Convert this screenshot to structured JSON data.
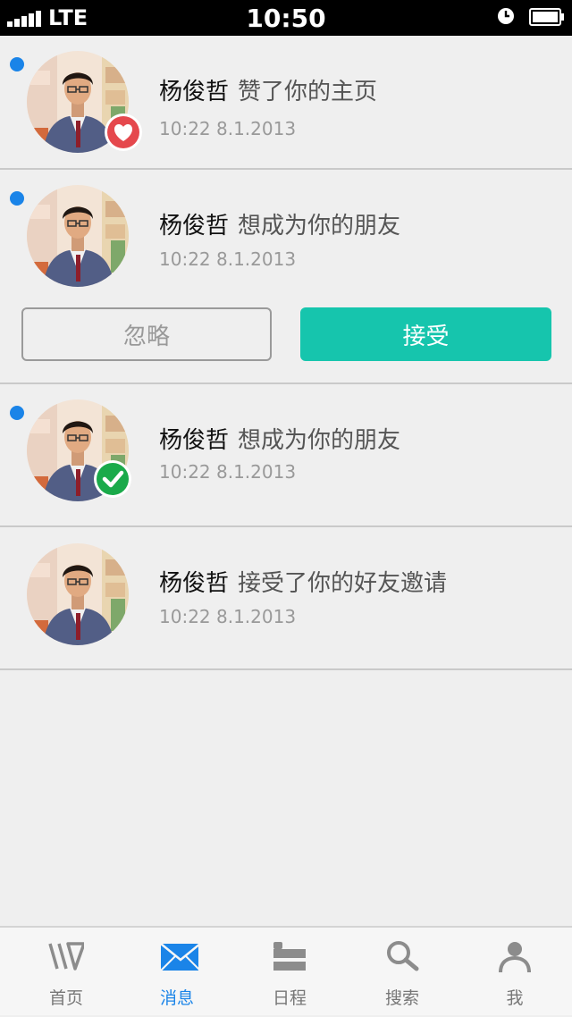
{
  "status_bar": {
    "carrier": "LTE",
    "time": "10:50"
  },
  "notifications": [
    {
      "name": "杨俊哲",
      "action": "赞了你的主页",
      "time": "10:22  8.1.2013",
      "unread": true,
      "badge": "heart-icon"
    },
    {
      "name": "杨俊哲",
      "action": "想成为你的朋友",
      "time": "10:22  8.1.2013",
      "unread": true,
      "badge": null,
      "buttons": {
        "ignore": "忽略",
        "accept": "接受"
      }
    },
    {
      "name": "杨俊哲",
      "action": "想成为你的朋友",
      "time": "10:22  8.1.2013",
      "unread": true,
      "badge": "check-icon"
    },
    {
      "name": "杨俊哲",
      "action": "接受了你的好友邀请",
      "time": "10:22  8.1.2013",
      "unread": false,
      "badge": null
    }
  ],
  "tab_bar": {
    "tabs": [
      {
        "label": "首页",
        "icon": "home-icon",
        "active": false
      },
      {
        "label": "消息",
        "icon": "envelope-icon",
        "active": true
      },
      {
        "label": "日程",
        "icon": "schedule-icon",
        "active": false
      },
      {
        "label": "搜索",
        "icon": "search-icon",
        "active": false
      },
      {
        "label": "我",
        "icon": "person-icon",
        "active": false
      }
    ]
  },
  "colors": {
    "accent_blue": "#1a84e8",
    "accept_green": "#16c5ad",
    "heart_red": "#e5484d",
    "check_green": "#1aaa4a",
    "background": "#efefef"
  }
}
